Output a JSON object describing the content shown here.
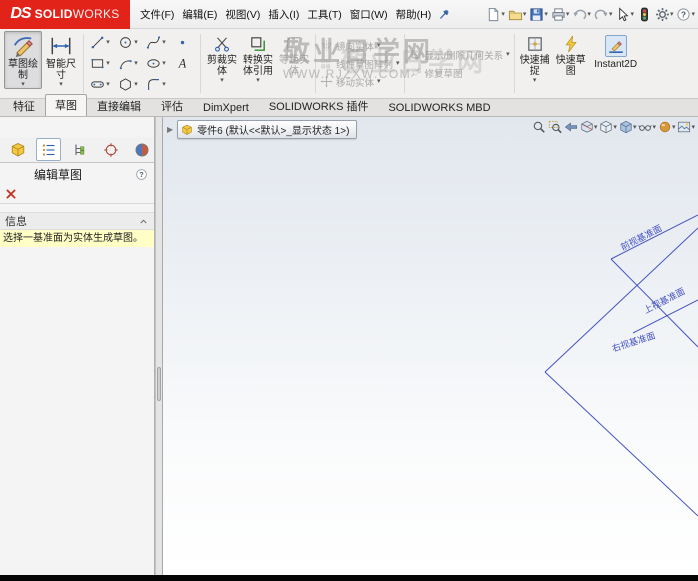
{
  "colors": {
    "brand_red": "#e2231a",
    "message_yellow": "#ffffc6",
    "plane_blue": "#4553c2"
  },
  "icons": {
    "chevron_down": "▾",
    "breadcrumb_arrow": "▶"
  },
  "titlebar": {
    "logo": {
      "ds": "DS",
      "brand_bold": "SOLID",
      "brand_light": "WORKS"
    },
    "menus": [
      "文件(F)",
      "编辑(E)",
      "视图(V)",
      "插入(I)",
      "工具(T)",
      "窗口(W)",
      "帮助(H)"
    ],
    "quick_access": [
      {
        "icon": "new-document",
        "dropdown": true
      },
      {
        "icon": "open-folder",
        "dropdown": true
      },
      {
        "icon": "save",
        "dropdown": true
      },
      {
        "icon": "print",
        "dropdown": true
      },
      {
        "icon": "undo",
        "dropdown": true
      },
      {
        "icon": "redo",
        "dropdown": true
      },
      {
        "icon": "select-pointer",
        "dropdown": true
      },
      {
        "icon": "rebuild-traffic-light",
        "dropdown": false
      },
      {
        "icon": "options-gear",
        "dropdown": true
      },
      {
        "icon": "help-question",
        "dropdown": true
      }
    ]
  },
  "ribbon": {
    "sketch_button": "草图绘制",
    "smart_dimension": "智能尺寸",
    "entity_grid": [
      [
        {
          "icon": "line",
          "dropdown": true
        },
        {
          "icon": "circle",
          "dropdown": true
        },
        {
          "icon": "spline",
          "dropdown": true
        },
        {
          "icon": "point",
          "dropdown": false
        }
      ],
      [
        {
          "icon": "rectangle",
          "dropdown": true
        },
        {
          "icon": "arc",
          "dropdown": true
        },
        {
          "icon": "ellipse",
          "dropdown": true
        },
        {
          "icon": "text-tool",
          "dropdown": false
        }
      ],
      [
        {
          "icon": "slot",
          "dropdown": true
        },
        {
          "icon": "polygon",
          "dropdown": true
        },
        {
          "icon": "fillet",
          "dropdown": true
        }
      ]
    ],
    "trim": "剪裁实体",
    "convert": "转换实体引用",
    "offset": "等距实体",
    "mirror": "镜向实体",
    "linear_pattern": "线性草图阵列",
    "move": "移动实体",
    "relations": "显示/删除几何关系",
    "repair": "修复草图",
    "quick_snaps": "快速捕捉",
    "rapid_sketch": "快速草图",
    "instant2d": "Instant2D"
  },
  "watermark": {
    "line1": "敬业日学网",
    "line2": "WWW.RJZXW.COM",
    "echo": "敬业日学网"
  },
  "tabbar": {
    "tabs": [
      {
        "label": "特征",
        "active": false
      },
      {
        "label": "草图",
        "active": true
      },
      {
        "label": "直接编辑",
        "active": false
      },
      {
        "label": "评估",
        "active": false
      },
      {
        "label": "DimXpert",
        "active": false
      },
      {
        "label": "SOLIDWORKS 插件",
        "active": false
      },
      {
        "label": "SOLIDWORKS MBD",
        "active": false
      }
    ]
  },
  "panel": {
    "manager_tabs": [
      {
        "icon": "feature-manager-part",
        "active": false
      },
      {
        "icon": "property-manager",
        "active": true
      },
      {
        "icon": "configuration-manager",
        "active": false
      },
      {
        "icon": "dimxpert-manager",
        "active": false
      },
      {
        "icon": "display-manager",
        "active": false
      }
    ],
    "title": "编辑草图",
    "message_header": "信息",
    "message": "选择一基准面为实体生成草图。"
  },
  "document": {
    "part_label": "零件6 (默认<<默认>_显示状态 1>)"
  },
  "viewport": {
    "hud_icons": [
      "zoom-fit",
      "zoom-area",
      "previous-view",
      "section-view",
      "view-orientation",
      "display-style",
      "hide-show-items",
      "edit-appearance",
      "apply-scene"
    ],
    "planes": [
      {
        "label": "前视基准面"
      },
      {
        "label": "上视基准面"
      },
      {
        "label": "右视基准面"
      }
    ]
  }
}
